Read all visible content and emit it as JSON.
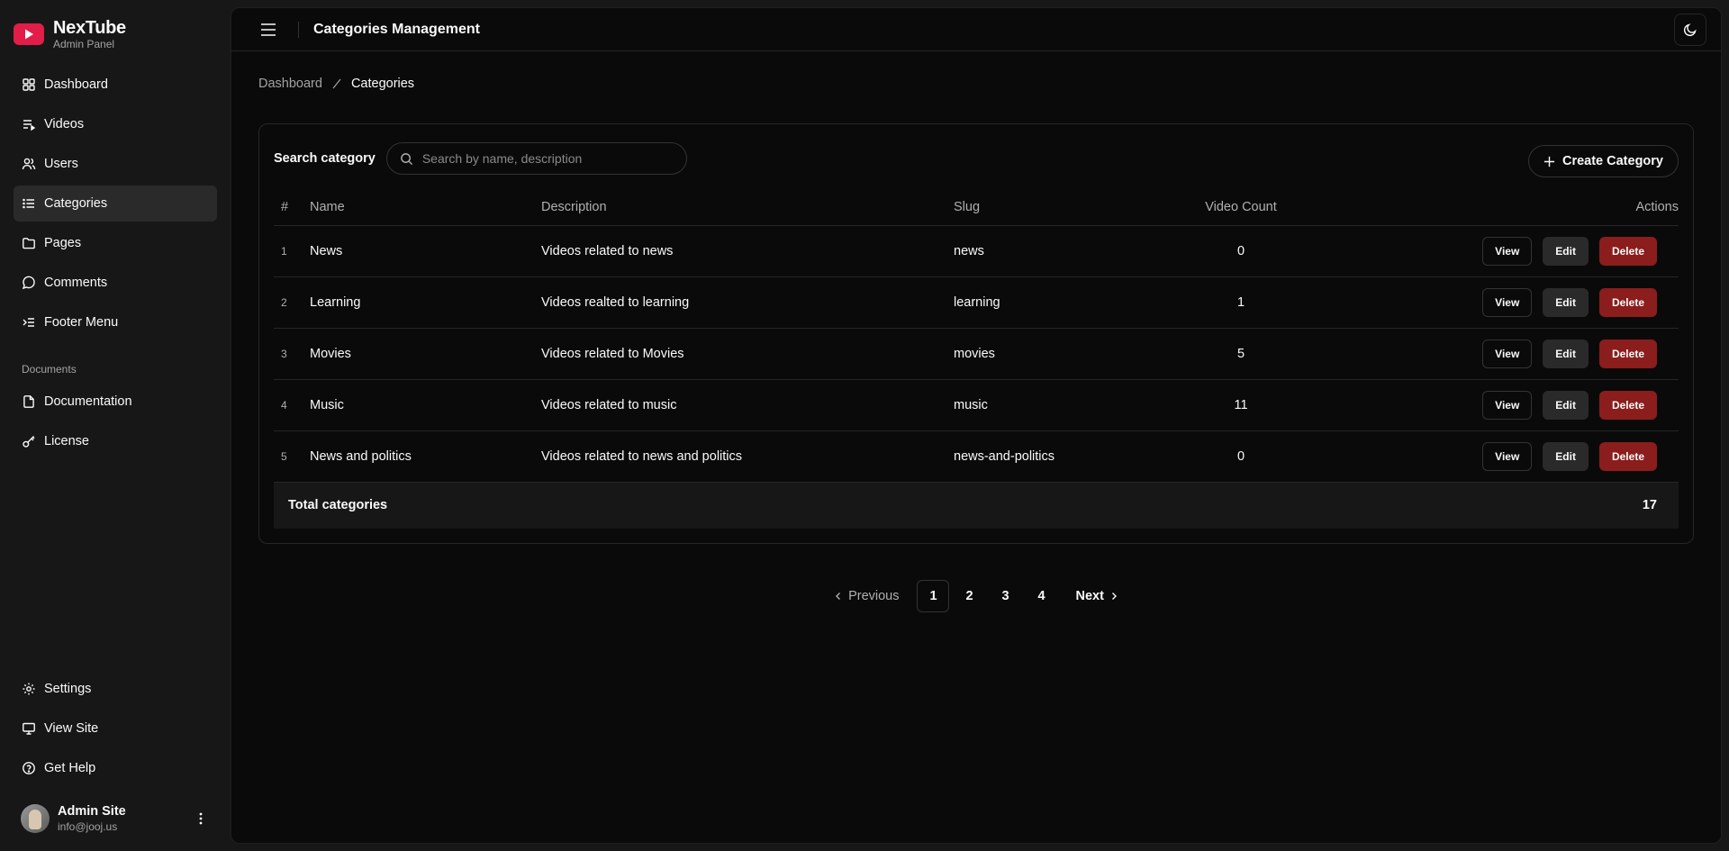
{
  "brand": {
    "title": "NexTube",
    "subtitle": "Admin Panel"
  },
  "nav": [
    {
      "label": "Dashboard",
      "icon": "dashboard-icon"
    },
    {
      "label": "Videos",
      "icon": "videos-icon"
    },
    {
      "label": "Users",
      "icon": "users-icon"
    },
    {
      "label": "Categories",
      "icon": "list-icon",
      "active": true
    },
    {
      "label": "Pages",
      "icon": "folder-icon"
    },
    {
      "label": "Comments",
      "icon": "comment-icon"
    },
    {
      "label": "Footer Menu",
      "icon": "footer-menu-icon"
    }
  ],
  "documents": {
    "section_label": "Documents",
    "items": [
      {
        "label": "Documentation",
        "icon": "file-icon"
      },
      {
        "label": "License",
        "icon": "key-icon"
      }
    ]
  },
  "bottom_nav": [
    {
      "label": "Settings",
      "icon": "gear-icon"
    },
    {
      "label": "View Site",
      "icon": "monitor-icon"
    },
    {
      "label": "Get Help",
      "icon": "help-icon"
    }
  ],
  "user": {
    "name": "Admin Site",
    "email": "info@jooj.us"
  },
  "header": {
    "title": "Categories Management"
  },
  "breadcrumb": {
    "home": "Dashboard",
    "current": "Categories"
  },
  "search": {
    "label": "Search category",
    "placeholder": "Search by name, description"
  },
  "create_button": "Create Category",
  "table": {
    "headers": {
      "num": "#",
      "name": "Name",
      "description": "Description",
      "slug": "Slug",
      "count": "Video Count",
      "actions": "Actions"
    },
    "rows": [
      {
        "num": "1",
        "name": "News",
        "description": "Videos related to news",
        "slug": "news",
        "count": "0"
      },
      {
        "num": "2",
        "name": "Learning",
        "description": "Videos realted to learning",
        "slug": "learning",
        "count": "1"
      },
      {
        "num": "3",
        "name": "Movies",
        "description": "Videos related to Movies",
        "slug": "movies",
        "count": "5"
      },
      {
        "num": "4",
        "name": "Music",
        "description": "Videos related to music",
        "slug": "music",
        "count": "11"
      },
      {
        "num": "5",
        "name": "News and politics",
        "description": "Videos related to news and politics",
        "slug": "news-and-politics",
        "count": "0"
      }
    ],
    "action_labels": {
      "view": "View",
      "edit": "Edit",
      "delete": "Delete"
    },
    "total_label": "Total categories",
    "total_value": "17"
  },
  "pagination": {
    "previous": "Previous",
    "next": "Next",
    "pages": [
      "1",
      "2",
      "3",
      "4"
    ],
    "current": "1"
  },
  "colors": {
    "delete": "#8b1d1d",
    "brand": "#e11d48",
    "background": "#0a0a0a",
    "sidebar": "#171717"
  }
}
